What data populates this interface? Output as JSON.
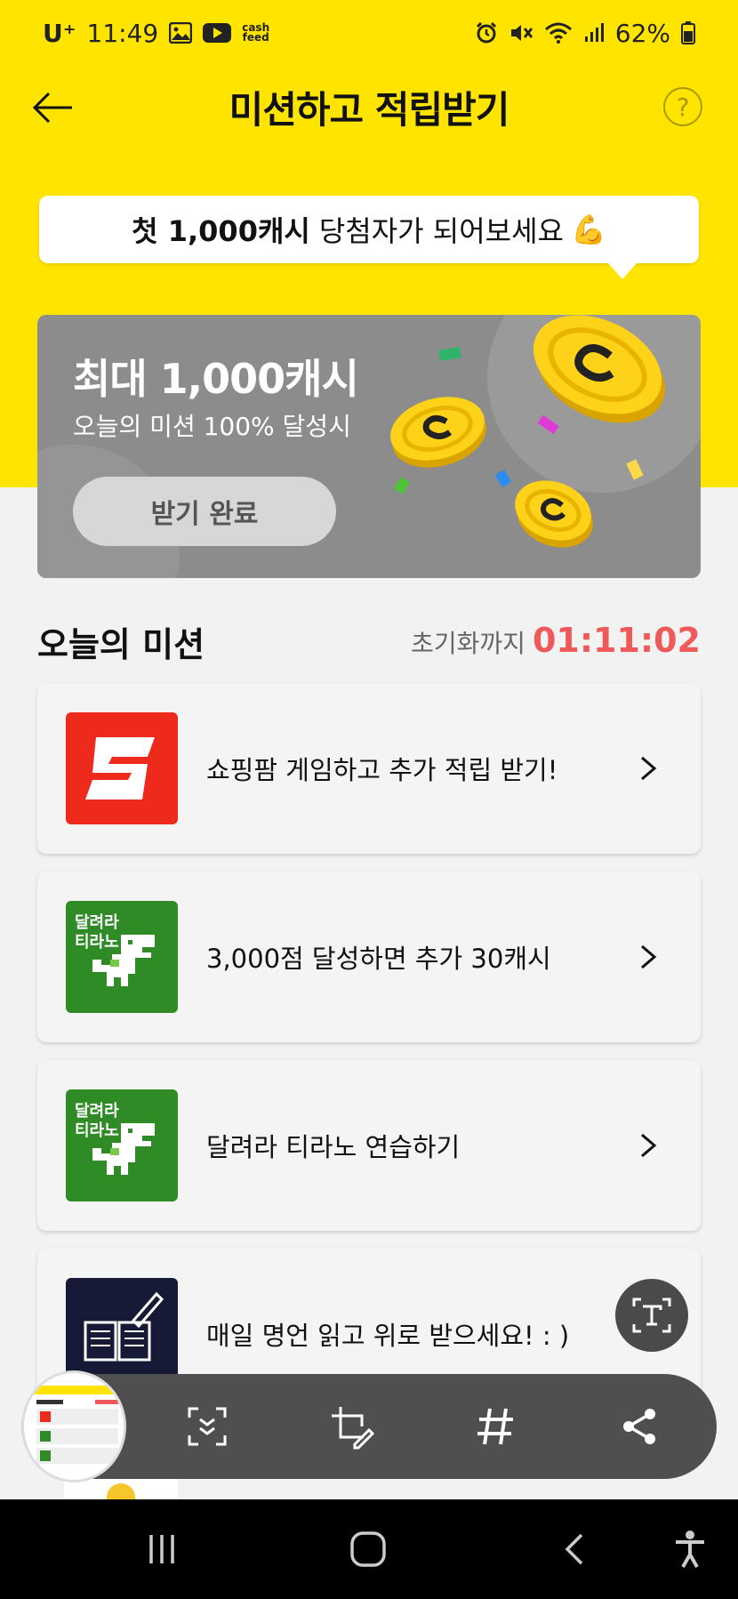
{
  "status_bar": {
    "carrier": "U⁺",
    "time": "11:49",
    "cashfeed_line1": "cash",
    "cashfeed_line2": "feed",
    "battery": "62%"
  },
  "header": {
    "title": "미션하고 적립받기",
    "help": "?"
  },
  "tooltip": {
    "bold": "첫 1,000캐시",
    "text": "당첨자가 되어보세요",
    "emoji": "💪"
  },
  "promo": {
    "title": "최대 1,000캐시",
    "subtitle": "오늘의 미션 100% 달성시",
    "button": "받기 완료"
  },
  "missions_section": {
    "title": "오늘의 미션",
    "reset_label": "초기화까지",
    "reset_timer": "01:11:02"
  },
  "missions": [
    {
      "label": "쇼핑팜 게임하고 추가 적립 받기!",
      "icon": "shopping-farm-icon"
    },
    {
      "label": "3,000점 달성하면 추가 30캐시",
      "icon": "tirano-game-icon",
      "thumb_line1": "달려라",
      "thumb_line2": "티라노"
    },
    {
      "label": "달려라 티라노 연습하기",
      "icon": "tirano-game-icon",
      "thumb_line1": "달려라",
      "thumb_line2": "티라노"
    },
    {
      "label": "매일 명언 읽고 위로 받으세요! : )",
      "icon": "book-quill-icon"
    }
  ],
  "colors": {
    "header_yellow": "#ffe400",
    "timer_red": "#ee5a5a",
    "promo_gray": "#8c8c8c"
  }
}
